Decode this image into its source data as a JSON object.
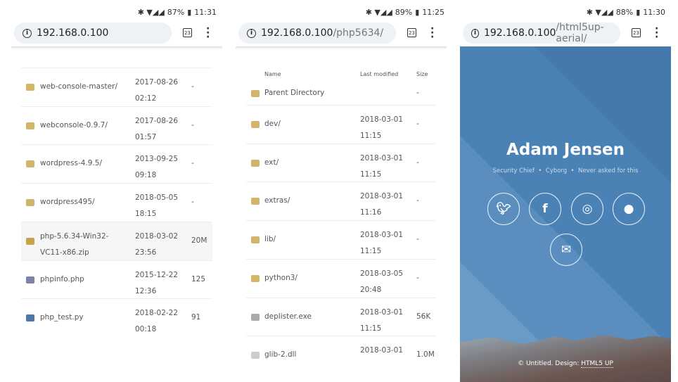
{
  "panels": [
    {
      "status": {
        "percent": "87%",
        "time": "11:31"
      },
      "url": {
        "host": "192.168.0.100",
        "path": ""
      },
      "tab_count": "23"
    },
    {
      "status": {
        "percent": "89%",
        "time": "11:25"
      },
      "url": {
        "host": "192.168.0.100",
        "path": "/php5634/"
      },
      "tab_count": "23"
    },
    {
      "status": {
        "percent": "88%",
        "time": "11:30"
      },
      "url": {
        "host": "192.168.0.100",
        "path": "/html5up-aerial/"
      },
      "tab_count": "23"
    }
  ],
  "listing1": [
    {
      "name": "web-console-master/",
      "date": "2017-08-26",
      "time": "02:12",
      "size": "-",
      "icon": "folder"
    },
    {
      "name": "webconsole-0.9.7/",
      "date": "2017-08-26",
      "time": "01:57",
      "size": "-",
      "icon": "folder"
    },
    {
      "name": "wordpress-4.9.5/",
      "date": "2013-09-25",
      "time": "09:18",
      "size": "-",
      "icon": "folder"
    },
    {
      "name": "wordpress495/",
      "date": "2018-05-05",
      "time": "18:15",
      "size": "-",
      "icon": "folder"
    },
    {
      "name": "php-5.6.34-Win32-VC11-x86.zip",
      "date": "2018-03-02",
      "time": "23:56",
      "size": "20M",
      "icon": "archive"
    },
    {
      "name": "phpinfo.php",
      "date": "2015-12-22",
      "time": "12:36",
      "size": "125",
      "icon": "php"
    },
    {
      "name": "php_test.py",
      "date": "2018-02-22",
      "time": "00:18",
      "size": "91",
      "icon": "python"
    }
  ],
  "listing2": {
    "headers": {
      "name": "Name",
      "modified": "Last modified",
      "size": "Size"
    },
    "parent": {
      "name": "Parent Directory",
      "size": "-"
    },
    "rows": [
      {
        "name": "dev/",
        "date": "2018-03-01",
        "time": "11:15",
        "size": "-",
        "icon": "folder"
      },
      {
        "name": "ext/",
        "date": "2018-03-01",
        "time": "11:15",
        "size": "-",
        "icon": "folder"
      },
      {
        "name": "extras/",
        "date": "2018-03-01",
        "time": "11:16",
        "size": "-",
        "icon": "folder"
      },
      {
        "name": "lib/",
        "date": "2018-03-01",
        "time": "11:15",
        "size": "-",
        "icon": "folder"
      },
      {
        "name": "python3/",
        "date": "2018-03-05",
        "time": "20:48",
        "size": "-",
        "icon": "folder"
      },
      {
        "name": "deplister.exe",
        "date": "2018-03-01",
        "time": "11:15",
        "size": "56K",
        "icon": "exe"
      },
      {
        "name": "glib-2.dll",
        "date": "2018-03-01",
        "time": "",
        "size": "1.0M",
        "icon": "unknown"
      }
    ]
  },
  "aerial": {
    "title": "Adam Jensen",
    "subtitle": "Security Chief  •  Cyborg  •  Never asked for this",
    "icons": [
      "twitter-icon",
      "facebook-icon",
      "dribbble-icon",
      "github-icon",
      "envelope-icon"
    ],
    "footer": "© Untitled. Design: ",
    "footer_link": "HTML5 UP",
    "accent": "#4b82b5"
  }
}
